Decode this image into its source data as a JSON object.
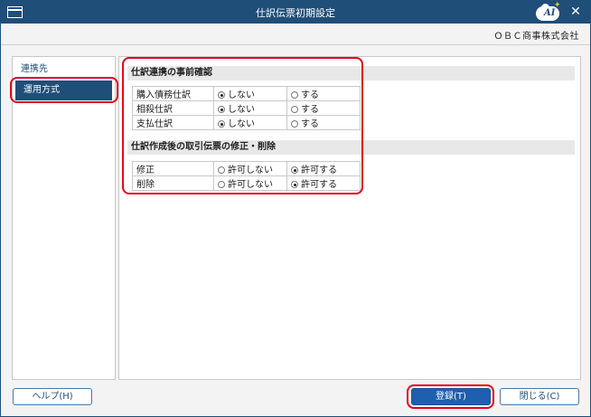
{
  "window": {
    "title": "仕訳伝票初期設定",
    "company": "ＯＢＣ商事株式会社",
    "logo_text": "AI"
  },
  "sidebar": {
    "items": [
      {
        "label": "連携先",
        "active": false
      },
      {
        "label": "運用方式",
        "active": true
      }
    ]
  },
  "section1": {
    "title": "仕訳連携の事前確認",
    "rows": [
      {
        "label": "購入債務仕訳",
        "opt1": "しない",
        "opt2": "する",
        "selected": 1
      },
      {
        "label": "相殺仕訳",
        "opt1": "しない",
        "opt2": "する",
        "selected": 1
      },
      {
        "label": "支払仕訳",
        "opt1": "しない",
        "opt2": "する",
        "selected": 1
      }
    ]
  },
  "section2": {
    "title": "仕訳作成後の取引伝票の修正・削除",
    "rows": [
      {
        "label": "修正",
        "opt1": "許可しない",
        "opt2": "許可する",
        "selected": 2
      },
      {
        "label": "削除",
        "opt1": "許可しない",
        "opt2": "許可する",
        "selected": 2
      }
    ]
  },
  "buttons": {
    "help": "ヘルプ(H)",
    "register": "登録(T)",
    "close": "閉じる(C)"
  },
  "colors": {
    "titlebar": "#1f4e79",
    "highlight": "#e3001b",
    "primary": "#1f5fb0"
  }
}
